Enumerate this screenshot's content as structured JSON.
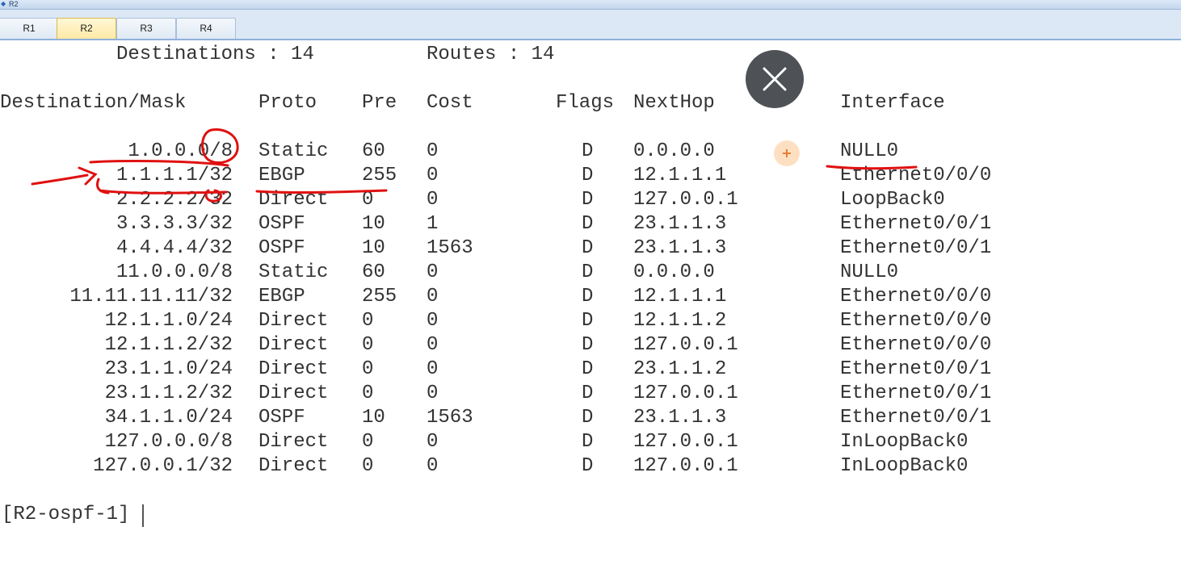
{
  "window": {
    "title": "R2",
    "icon": "network-icon"
  },
  "tabs": [
    {
      "label": "R1",
      "active": false
    },
    {
      "label": "R2",
      "active": true
    },
    {
      "label": "R3",
      "active": false
    },
    {
      "label": "R4",
      "active": false
    }
  ],
  "summary": {
    "destinations": "Destinations : 14",
    "routes": "Routes : 14"
  },
  "table": {
    "headers": [
      "Destination/Mask",
      "Proto",
      "Pre",
      "Cost",
      "Flags",
      "NextHop",
      "Interface"
    ],
    "rows": [
      [
        "1.0.0.0/8",
        "Static",
        "60",
        "0",
        "D",
        "0.0.0.0",
        "NULL0"
      ],
      [
        "1.1.1.1/32",
        "EBGP",
        "255",
        "0",
        "D",
        "12.1.1.1",
        "Ethernet0/0/0"
      ],
      [
        "2.2.2.2/32",
        "Direct",
        "0",
        "0",
        "D",
        "127.0.0.1",
        "LoopBack0"
      ],
      [
        "3.3.3.3/32",
        "OSPF",
        "10",
        "1",
        "D",
        "23.1.1.3",
        "Ethernet0/0/1"
      ],
      [
        "4.4.4.4/32",
        "OSPF",
        "10",
        "1563",
        "D",
        "23.1.1.3",
        "Ethernet0/0/1"
      ],
      [
        "11.0.0.0/8",
        "Static",
        "60",
        "0",
        "D",
        "0.0.0.0",
        "NULL0"
      ],
      [
        "11.11.11.11/32",
        "EBGP",
        "255",
        "0",
        "D",
        "12.1.1.1",
        "Ethernet0/0/0"
      ],
      [
        "12.1.1.0/24",
        "Direct",
        "0",
        "0",
        "D",
        "12.1.1.2",
        "Ethernet0/0/0"
      ],
      [
        "12.1.1.2/32",
        "Direct",
        "0",
        "0",
        "D",
        "127.0.0.1",
        "Ethernet0/0/0"
      ],
      [
        "23.1.1.0/24",
        "Direct",
        "0",
        "0",
        "D",
        "23.1.1.2",
        "Ethernet0/0/1"
      ],
      [
        "23.1.1.2/32",
        "Direct",
        "0",
        "0",
        "D",
        "127.0.0.1",
        "Ethernet0/0/1"
      ],
      [
        "34.1.1.0/24",
        "OSPF",
        "10",
        "1563",
        "D",
        "23.1.1.3",
        "Ethernet0/0/1"
      ],
      [
        "127.0.0.0/8",
        "Direct",
        "0",
        "0",
        "D",
        "127.0.0.1",
        "InLoopBack0"
      ],
      [
        "127.0.0.1/32",
        "Direct",
        "0",
        "0",
        "D",
        "127.0.0.1",
        "InLoopBack0"
      ]
    ]
  },
  "prompt": "[R2-ospf-1]",
  "overlay": {
    "close_icon": "close-icon",
    "marker_icon": "plus-marker-icon",
    "marker_glyph": "+"
  },
  "colors": {
    "annotation_ink": "#e01010",
    "close_button": "#4e5257",
    "marker_bg": "#fde0c2",
    "marker_fg": "#e7772f"
  }
}
